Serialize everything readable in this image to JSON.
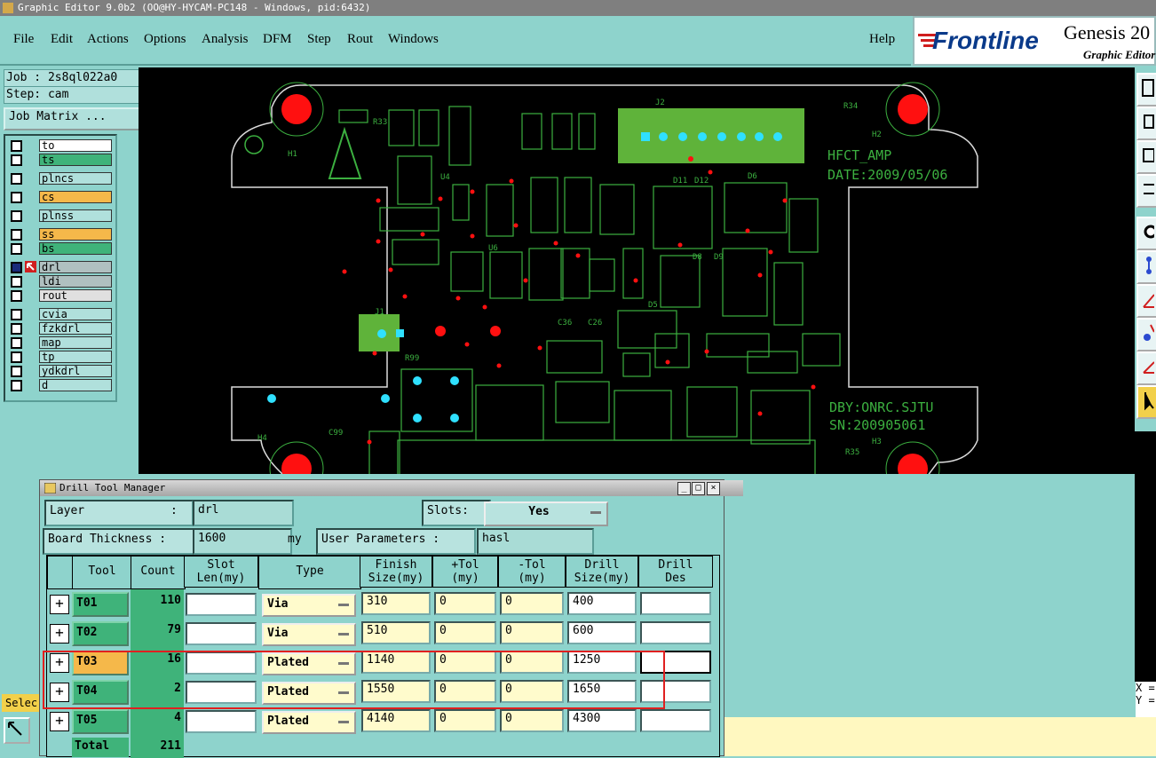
{
  "window": {
    "title": "Graphic Editor 9.0b2 (OO@HY-HYCAM-PC148 - Windows, pid:6432)"
  },
  "menu": [
    "File",
    "Edit",
    "Actions",
    "Options",
    "Analysis",
    "DFM",
    "Step",
    "Rout",
    "Windows"
  ],
  "help": "Help",
  "brand": {
    "logo": "Frontline",
    "product": "Genesis 20",
    "subtitle": "Graphic Editor"
  },
  "job": {
    "job_label": "Job : 2s8ql022a0",
    "step_label": "Step: cam",
    "matrix_button": "Job Matrix ..."
  },
  "layers": [
    {
      "name": "to",
      "color": "#ffffff"
    },
    {
      "name": "ts",
      "color": "#3fb37a"
    },
    {
      "name": "plncs",
      "color": "#b0e0dc"
    },
    {
      "name": "cs",
      "color": "#f5b84a"
    },
    {
      "name": "plnss",
      "color": "#b0e0dc"
    },
    {
      "name": "ss",
      "color": "#f5b84a"
    },
    {
      "name": "bs",
      "color": "#3fb37a"
    },
    {
      "name": "drl",
      "color": "#b0c0c0"
    },
    {
      "name": "ldi",
      "color": "#b0c0c0"
    },
    {
      "name": "rout",
      "color": "#e0e0e0"
    },
    {
      "name": "cvia",
      "color": "#b0e0dc"
    },
    {
      "name": "fzkdrl",
      "color": "#b0e0dc"
    },
    {
      "name": "map",
      "color": "#b0e0dc"
    },
    {
      "name": "tp",
      "color": "#b0e0dc"
    },
    {
      "name": "ydkdrl",
      "color": "#b0e0dc"
    },
    {
      "name": "d",
      "color": "#b0e0dc"
    }
  ],
  "select_label": "Selec",
  "coords": {
    "x": "X =",
    "y": "Y ="
  },
  "pcb": {
    "text1": "HFCT_AMP",
    "text2": "DATE:2009/05/06",
    "text3": "DBY:ONRC.SJTU",
    "text4": "SN:200905061",
    "refs": [
      "H1",
      "H2",
      "H3",
      "H4",
      "J1",
      "J2",
      "R33",
      "R34",
      "R35",
      "C99",
      "R99",
      "D5",
      "D6",
      "D8",
      "D9",
      "D11",
      "D12",
      "U4",
      "U6",
      "C26",
      "C36"
    ]
  },
  "dialog": {
    "title": "Drill Tool Manager",
    "layer_label": "Layer",
    "layer_colon": ":",
    "layer_value": "drl",
    "slots_label": "Slots:",
    "slots_value": "Yes",
    "thickness_label": "Board Thickness :",
    "thickness_value": "1600",
    "thickness_unit": "my",
    "user_params_label": "User Parameters :",
    "user_params_value": "hasl",
    "columns": [
      "Tool",
      "Count",
      "Slot Len(my)",
      "Type",
      "Finish Size(my)",
      "+Tol (my)",
      "-Tol (my)",
      "Drill Size(my)",
      "Drill Des"
    ],
    "rows": [
      {
        "tool": "T01",
        "count": "110",
        "slot": "",
        "type": "Via",
        "finish": "310",
        "ptol": "0",
        "mtol": "0",
        "drill": "400",
        "des": ""
      },
      {
        "tool": "T02",
        "count": "79",
        "slot": "",
        "type": "Via",
        "finish": "510",
        "ptol": "0",
        "mtol": "0",
        "drill": "600",
        "des": ""
      },
      {
        "tool": "T03",
        "count": "16",
        "slot": "",
        "type": "Plated",
        "finish": "1140",
        "ptol": "0",
        "mtol": "0",
        "drill": "1250",
        "des": ""
      },
      {
        "tool": "T04",
        "count": "2",
        "slot": "",
        "type": "Plated",
        "finish": "1550",
        "ptol": "0",
        "mtol": "0",
        "drill": "1650",
        "des": ""
      },
      {
        "tool": "T05",
        "count": "4",
        "slot": "",
        "type": "Plated",
        "finish": "4140",
        "ptol": "0",
        "mtol": "0",
        "drill": "4300",
        "des": ""
      }
    ],
    "total_label": "Total",
    "total_value": "211",
    "highlight_color": "#e02020"
  }
}
